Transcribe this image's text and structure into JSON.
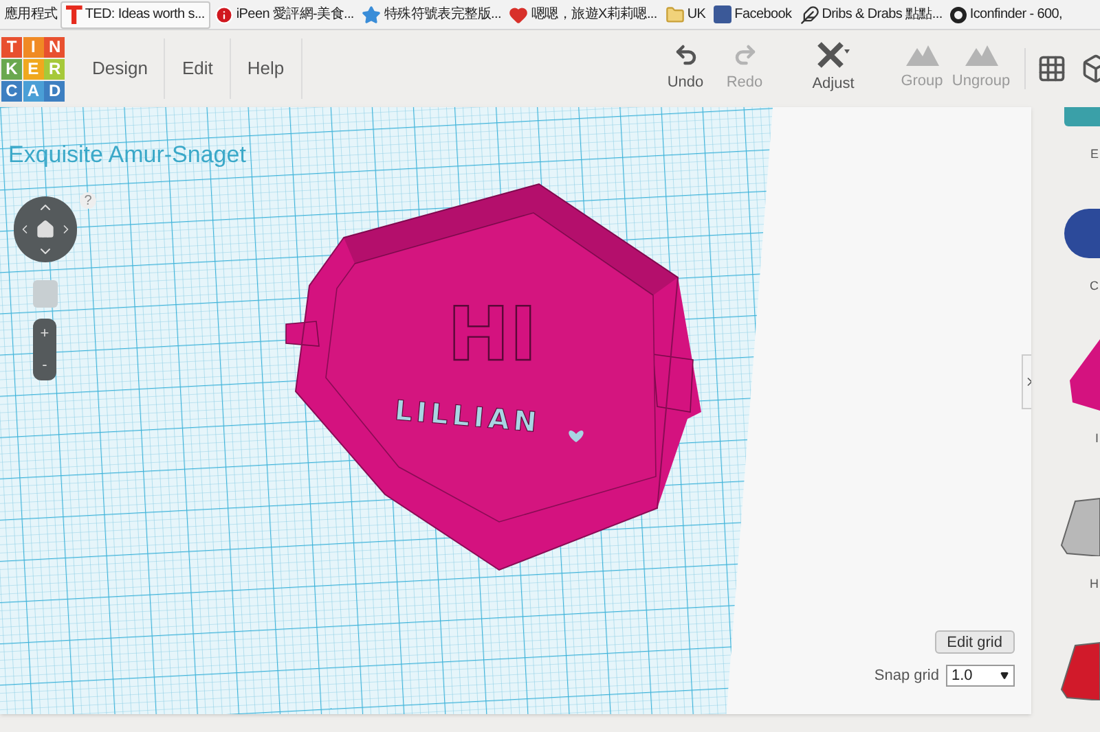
{
  "bookmarks": [
    {
      "kind": "apps",
      "label": "應用程式"
    },
    {
      "kind": "letter",
      "label": "TED: Ideas worth s...",
      "selected": true
    },
    {
      "kind": "info",
      "label": "iPeen 愛評網-美食...",
      "selected": false
    },
    {
      "kind": "star",
      "label": "特殊符號表完整版...",
      "selected": false
    },
    {
      "kind": "heart",
      "label": "嗯嗯，旅遊X莉莉嗯...",
      "selected": false
    },
    {
      "kind": "folder",
      "label": "UK",
      "selected": false
    },
    {
      "kind": "facebook",
      "label": "Facebook",
      "selected": false
    },
    {
      "kind": "feather",
      "label": "Dribs & Drabs 點點...",
      "selected": false
    },
    {
      "kind": "logo",
      "label": "Iconfinder - 600,",
      "selected": false
    }
  ],
  "logo": [
    {
      "letter": "T",
      "color": "#e8502f"
    },
    {
      "letter": "I",
      "color": "#f08a24"
    },
    {
      "letter": "N",
      "color": "#e8502f"
    },
    {
      "letter": "K",
      "color": "#6aa84f"
    },
    {
      "letter": "E",
      "color": "#f0a81e"
    },
    {
      "letter": "R",
      "color": "#a6c93a"
    },
    {
      "letter": "C",
      "color": "#3d7fc1"
    },
    {
      "letter": "A",
      "color": "#4a9fd6"
    },
    {
      "letter": "D",
      "color": "#3d7fc1"
    }
  ],
  "menu": [
    "Design",
    "Edit",
    "Help"
  ],
  "tools": [
    {
      "kind": "undo",
      "label": "Undo",
      "disabled": false
    },
    {
      "kind": "redo",
      "label": "Redo",
      "disabled": true
    },
    {
      "kind": "adjust",
      "label": "Adjust",
      "disabled": false
    },
    {
      "kind": "group",
      "label": "Group",
      "disabled": true
    },
    {
      "kind": "ungroup",
      "label": "Ungroup",
      "disabled": true
    }
  ],
  "design_title": "Exquisite Amur-Snaget",
  "help_mark": "?",
  "zoom": {
    "plus": "+",
    "minus": "-"
  },
  "model": {
    "big_text": "HI",
    "name_text": "LILLIAN",
    "color": "#d4127f"
  },
  "grid": {
    "edit_button": "Edit grid",
    "snap_label": "Snap grid",
    "snap_value": "1.0"
  },
  "shapes": [
    {
      "kind": "box",
      "label": "E",
      "color": "#3aa0a8"
    },
    {
      "kind": "cylinder",
      "label": "C",
      "color": "#2c4a9a"
    },
    {
      "kind": "wedge",
      "label": "I",
      "color": "#d4127f"
    },
    {
      "kind": "letter",
      "label": "H",
      "color": "#b8b8b8"
    },
    {
      "kind": "letter",
      "color": "#d11a2a"
    }
  ]
}
